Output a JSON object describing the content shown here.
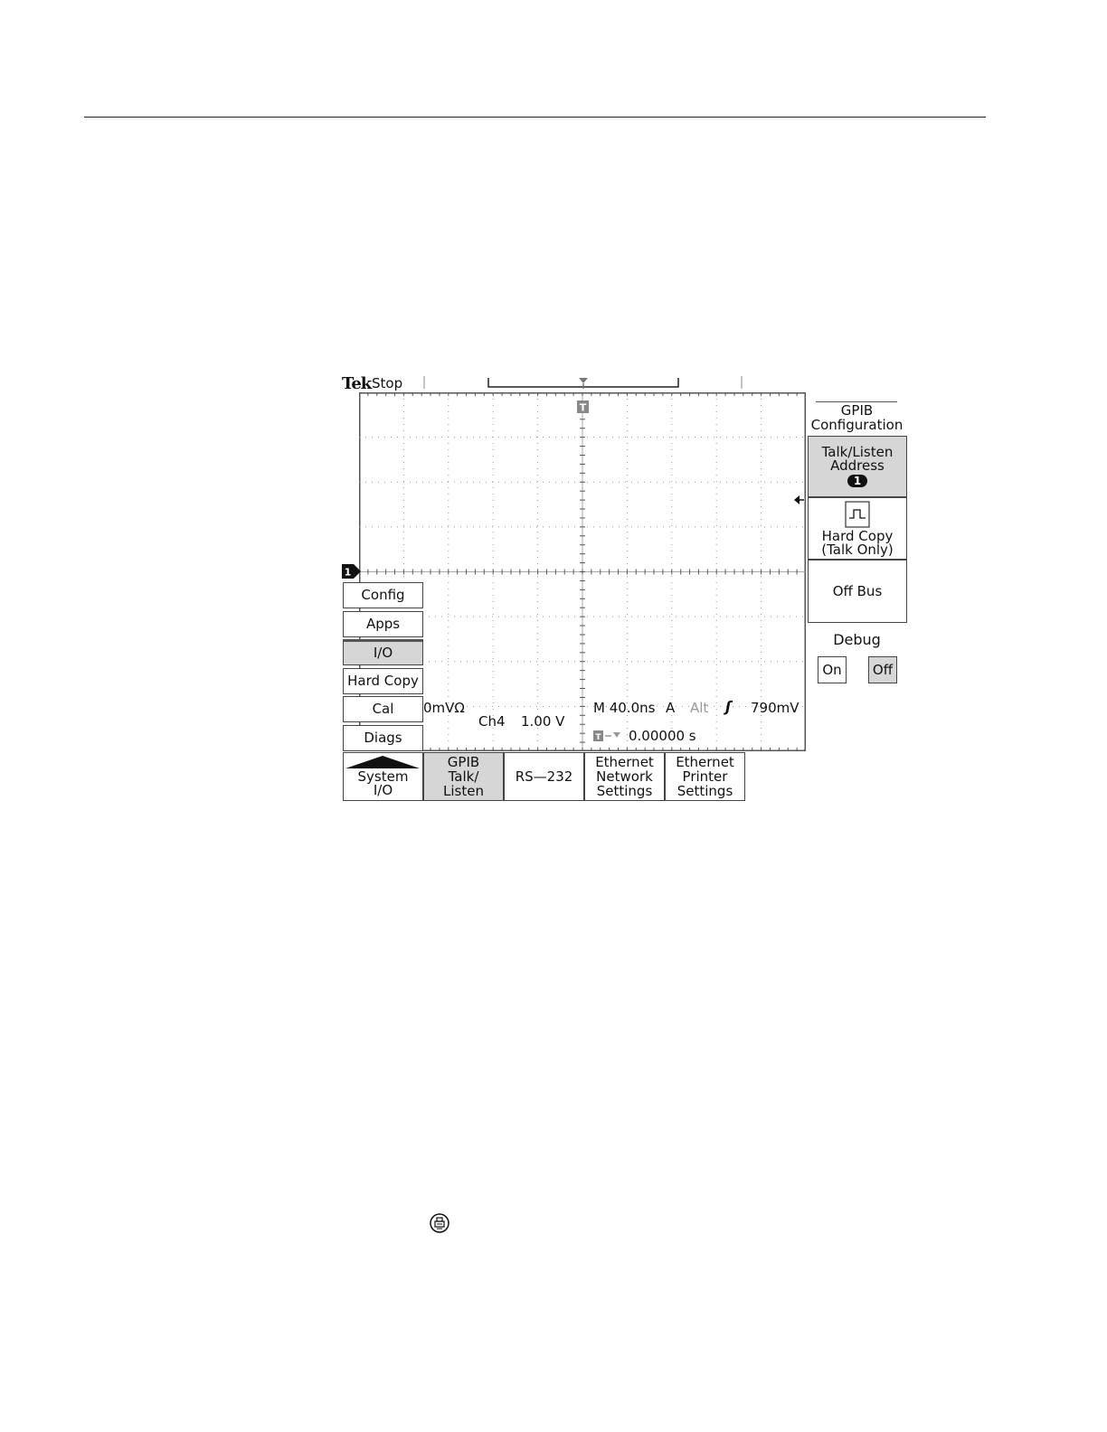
{
  "scope": {
    "logo": "Tek",
    "acq_state": "Stop",
    "ch1_marker": "1",
    "trigger_marker": "T"
  },
  "menu_left": [
    {
      "label": "Config",
      "selected": false
    },
    {
      "label": "Apps",
      "selected": false
    },
    {
      "label": "I/O",
      "selected": true
    },
    {
      "label": "Hard Copy",
      "selected": false
    },
    {
      "label": "Cal",
      "selected": false
    },
    {
      "label": "Diags",
      "selected": false
    }
  ],
  "menu_title": {
    "line1": "System",
    "line2": "I/O"
  },
  "bottom_tabs": [
    {
      "line1": "GPIB",
      "line2": "Talk/",
      "line3": "Listen",
      "selected": true
    },
    {
      "line1": "",
      "line2": "RS—232",
      "line3": "",
      "selected": false
    },
    {
      "line1": "Ethernet",
      "line2": "Network",
      "line3": "Settings",
      "selected": false
    },
    {
      "line1": "Ethernet",
      "line2": "Printer",
      "line3": "Settings",
      "selected": false
    }
  ],
  "side_menu": {
    "title_line1": "GPIB",
    "title_line2": "Configuration",
    "talk_listen": {
      "line1": "Talk/Listen",
      "line2": "Address",
      "value": "1"
    },
    "hard_copy": {
      "line1": "Hard Copy",
      "line2": "(Talk Only)"
    },
    "off_bus": "Off Bus",
    "debug_label": "Debug",
    "debug_on": "On",
    "debug_off": "Off"
  },
  "readouts": {
    "ch_scale_left": "0mVΩ",
    "ch4": "Ch4",
    "ch4_scale": "1.00 V",
    "timebase": "M 40.0ns",
    "trig_source": "A",
    "trig_mode": "Alt",
    "trig_slope": "ʃ",
    "trig_level": "790mV",
    "trig_position": "0.00000 s"
  },
  "icons": {
    "print_icon": "print-icon",
    "square_wave_icon": "square-wave-icon"
  }
}
